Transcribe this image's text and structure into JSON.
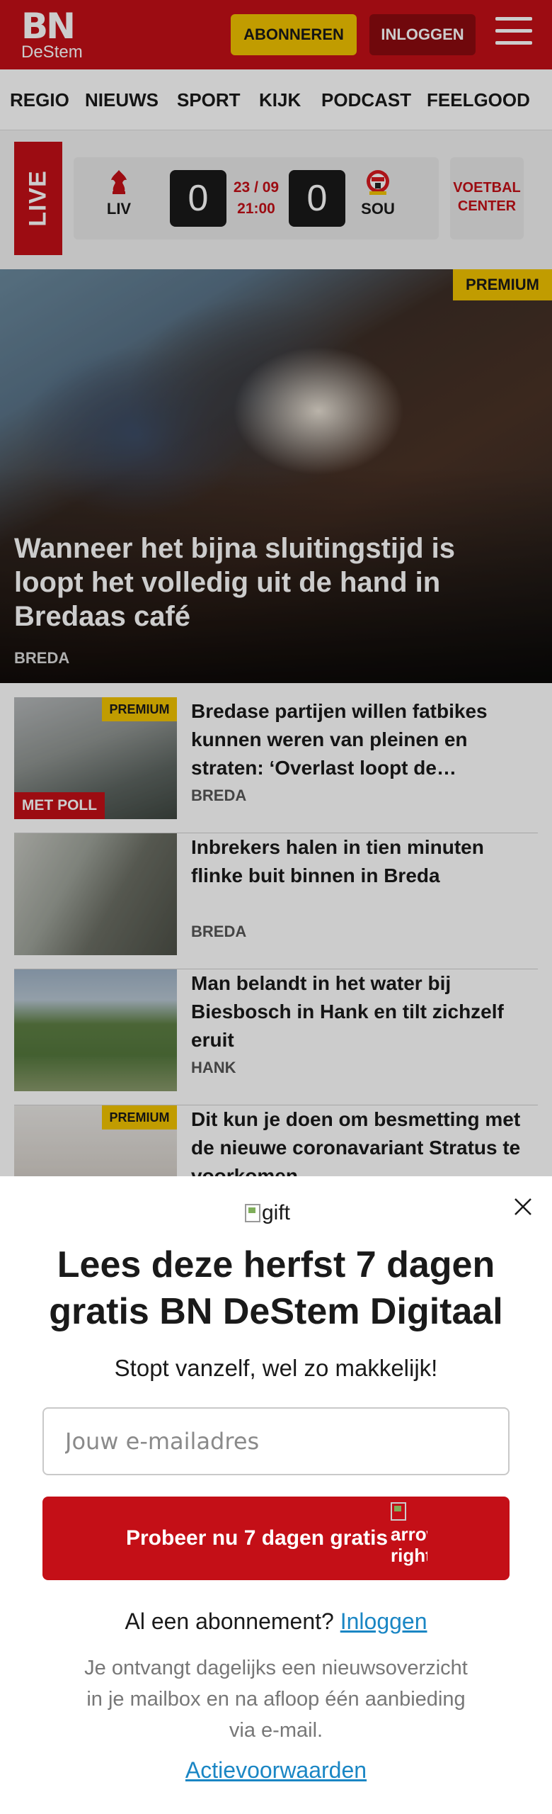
{
  "header": {
    "logo_bn": "BN",
    "logo_destem": "DeStem",
    "subscribe_label": "ABONNEREN",
    "login_label": "INLOGGEN",
    "menu_icon": "hamburger-icon",
    "color": "#c40f17"
  },
  "nav": {
    "items": [
      {
        "label": "REGIO"
      },
      {
        "label": "NIEUWS"
      },
      {
        "label": "SPORT"
      },
      {
        "label": "KIJK"
      },
      {
        "label": "PODCAST"
      },
      {
        "label": "FEELGOOD"
      }
    ]
  },
  "live": {
    "label": "LIVE",
    "home_team": "LIV",
    "away_team": "SOU",
    "home_score": "0",
    "away_score": "0",
    "date": "23 / 09",
    "time": "21:00",
    "center_label": "VOETBAL CENTER"
  },
  "hero": {
    "badge": "PREMIUM",
    "title": "Wanneer het bijna sluitingstijd is loopt het volledig uit de hand in Bredaas café",
    "location": "BREDA"
  },
  "articles": [
    {
      "badge": "PREMIUM",
      "tag": "MET POLL",
      "title": "Bredase partijen willen fatbikes kunnen weren van pleinen en straten: ‘Overlast loopt de…",
      "location": "BREDA"
    },
    {
      "title": "Inbrekers halen in tien minuten flinke buit binnen in Breda",
      "location": "BREDA"
    },
    {
      "title": "Man belandt in het water bij Biesbosch in Hank en tilt zichzelf eruit",
      "location": "HANK"
    },
    {
      "badge": "PREMIUM",
      "title": "Dit kun je doen om besmetting met de nieuwe coronavariant Stratus te voorkomen"
    }
  ],
  "modal": {
    "gift_alt": "gift",
    "title": "Lees deze herfst 7 dagen gratis BN DeStem Digitaal",
    "subtitle": "Stopt vanzelf, wel zo makkelijk!",
    "email_placeholder": "Jouw e-mailadres",
    "cta_label": "Probeer nu 7 dagen gratis",
    "cta_arrow_alt": "arrow right",
    "have_sub_text": "Al een abonnement?",
    "login_link": "Inloggen",
    "fine_print": "Je ontvangt dagelijks een nieuwsoverzicht in je mailbox en na afloop één aanbieding via e-mail.",
    "terms_link": "Actievoorwaarden"
  }
}
